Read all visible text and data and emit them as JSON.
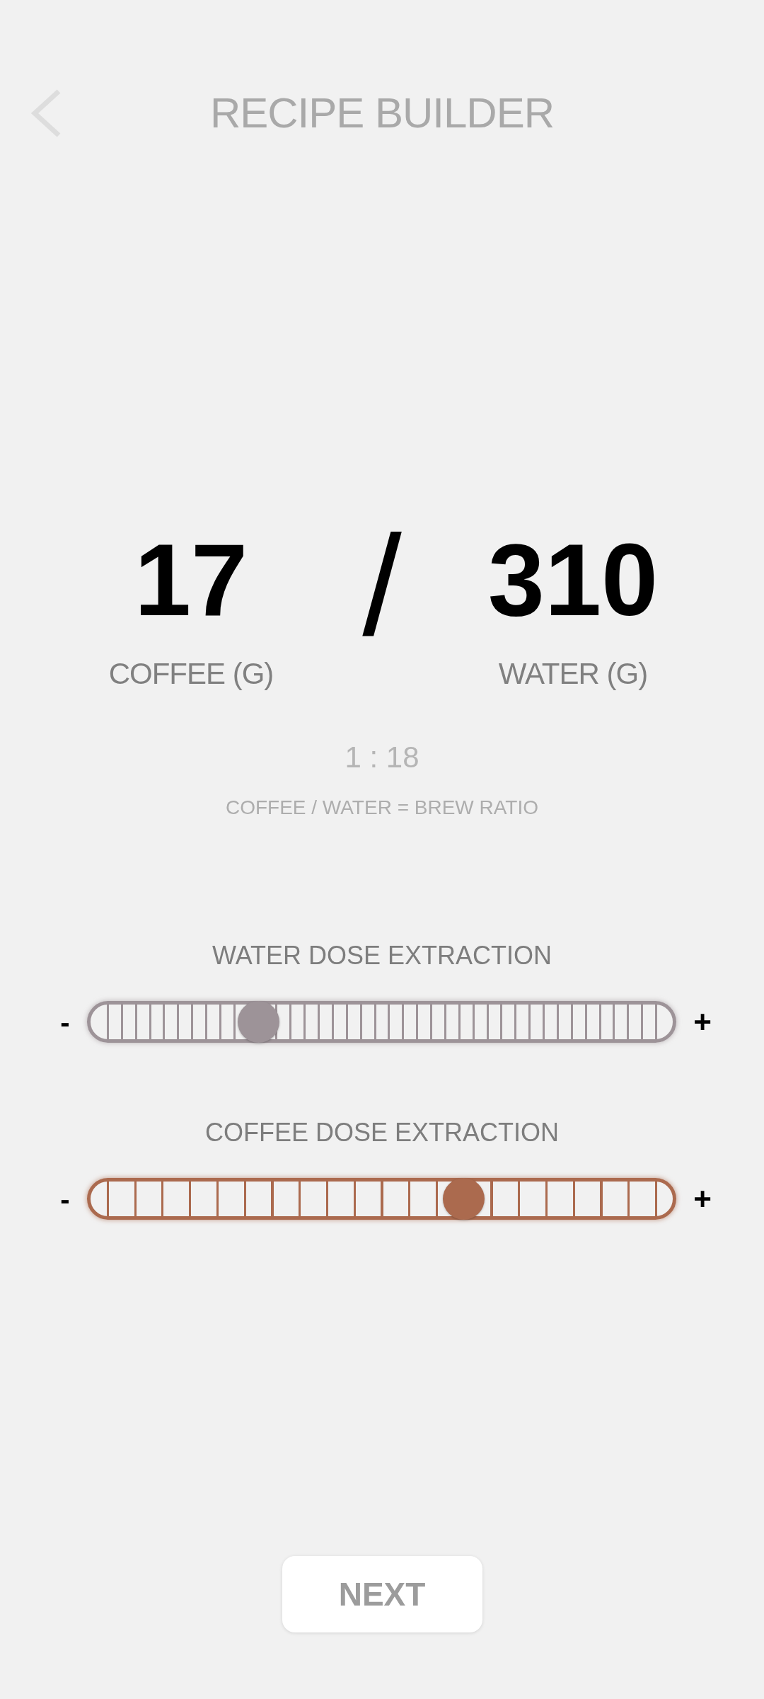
{
  "header": {
    "title": "RECIPE BUILDER"
  },
  "dose": {
    "coffee": {
      "value": "17",
      "label": "COFFEE (G)"
    },
    "separator": "/",
    "water": {
      "value": "310",
      "label": "WATER (G)"
    }
  },
  "ratio": {
    "value": "1 : 18",
    "caption": "COFFEE / WATER = BREW RATIO"
  },
  "sliders": [
    {
      "label": "WATER DOSE EXTRACTION",
      "kind": "fine",
      "color": "#9d9398",
      "level": 0.275,
      "minus": "-",
      "plus": "+"
    },
    {
      "label": "COFFEE DOSE EXTRACTION",
      "kind": "coarse",
      "color": "#ab6a4e",
      "level": 0.65,
      "minus": "-",
      "plus": "+"
    }
  ],
  "next_button": {
    "label": "NEXT"
  }
}
